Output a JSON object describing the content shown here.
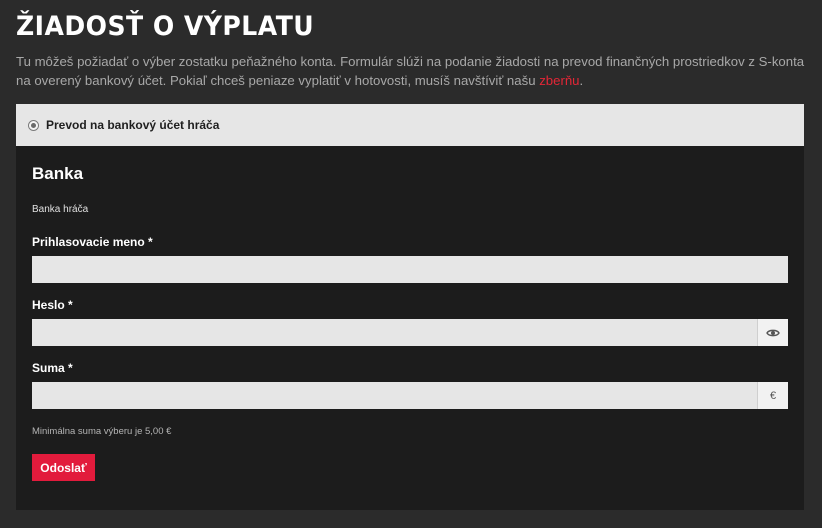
{
  "page": {
    "title": "ŽIADOSŤ O VÝPLATU",
    "intro_text": "Tu môžeš požiadať o výber zostatku peňažného konta. Formulár slúži na podanie žiadosti na prevod finančných prostriedkov z S-konta na overený bankový účet. Pokiaľ chceš peniaze vyplatiť v hotovosti, musíš navštíviť našu ",
    "intro_link": "zberňu",
    "intro_end": "."
  },
  "payout_option": {
    "label": "Prevod na bankový účet hráča",
    "selected": true
  },
  "form": {
    "section_title": "Banka",
    "sub_label": "Banka hráča",
    "username": {
      "label": "Prihlasovacie meno *",
      "value": ""
    },
    "password": {
      "label": "Heslo *",
      "value": ""
    },
    "amount": {
      "label": "Suma *",
      "value": "",
      "currency": "€"
    },
    "hint": "Minimálna suma výberu je 5,00 €",
    "submit_label": "Odoslať"
  },
  "colors": {
    "accent": "#e21b3c",
    "link": "#e32636",
    "background": "#2b2b2b",
    "panel": "#1c1c1c"
  },
  "icons": {
    "password_toggle": "eye-icon"
  }
}
